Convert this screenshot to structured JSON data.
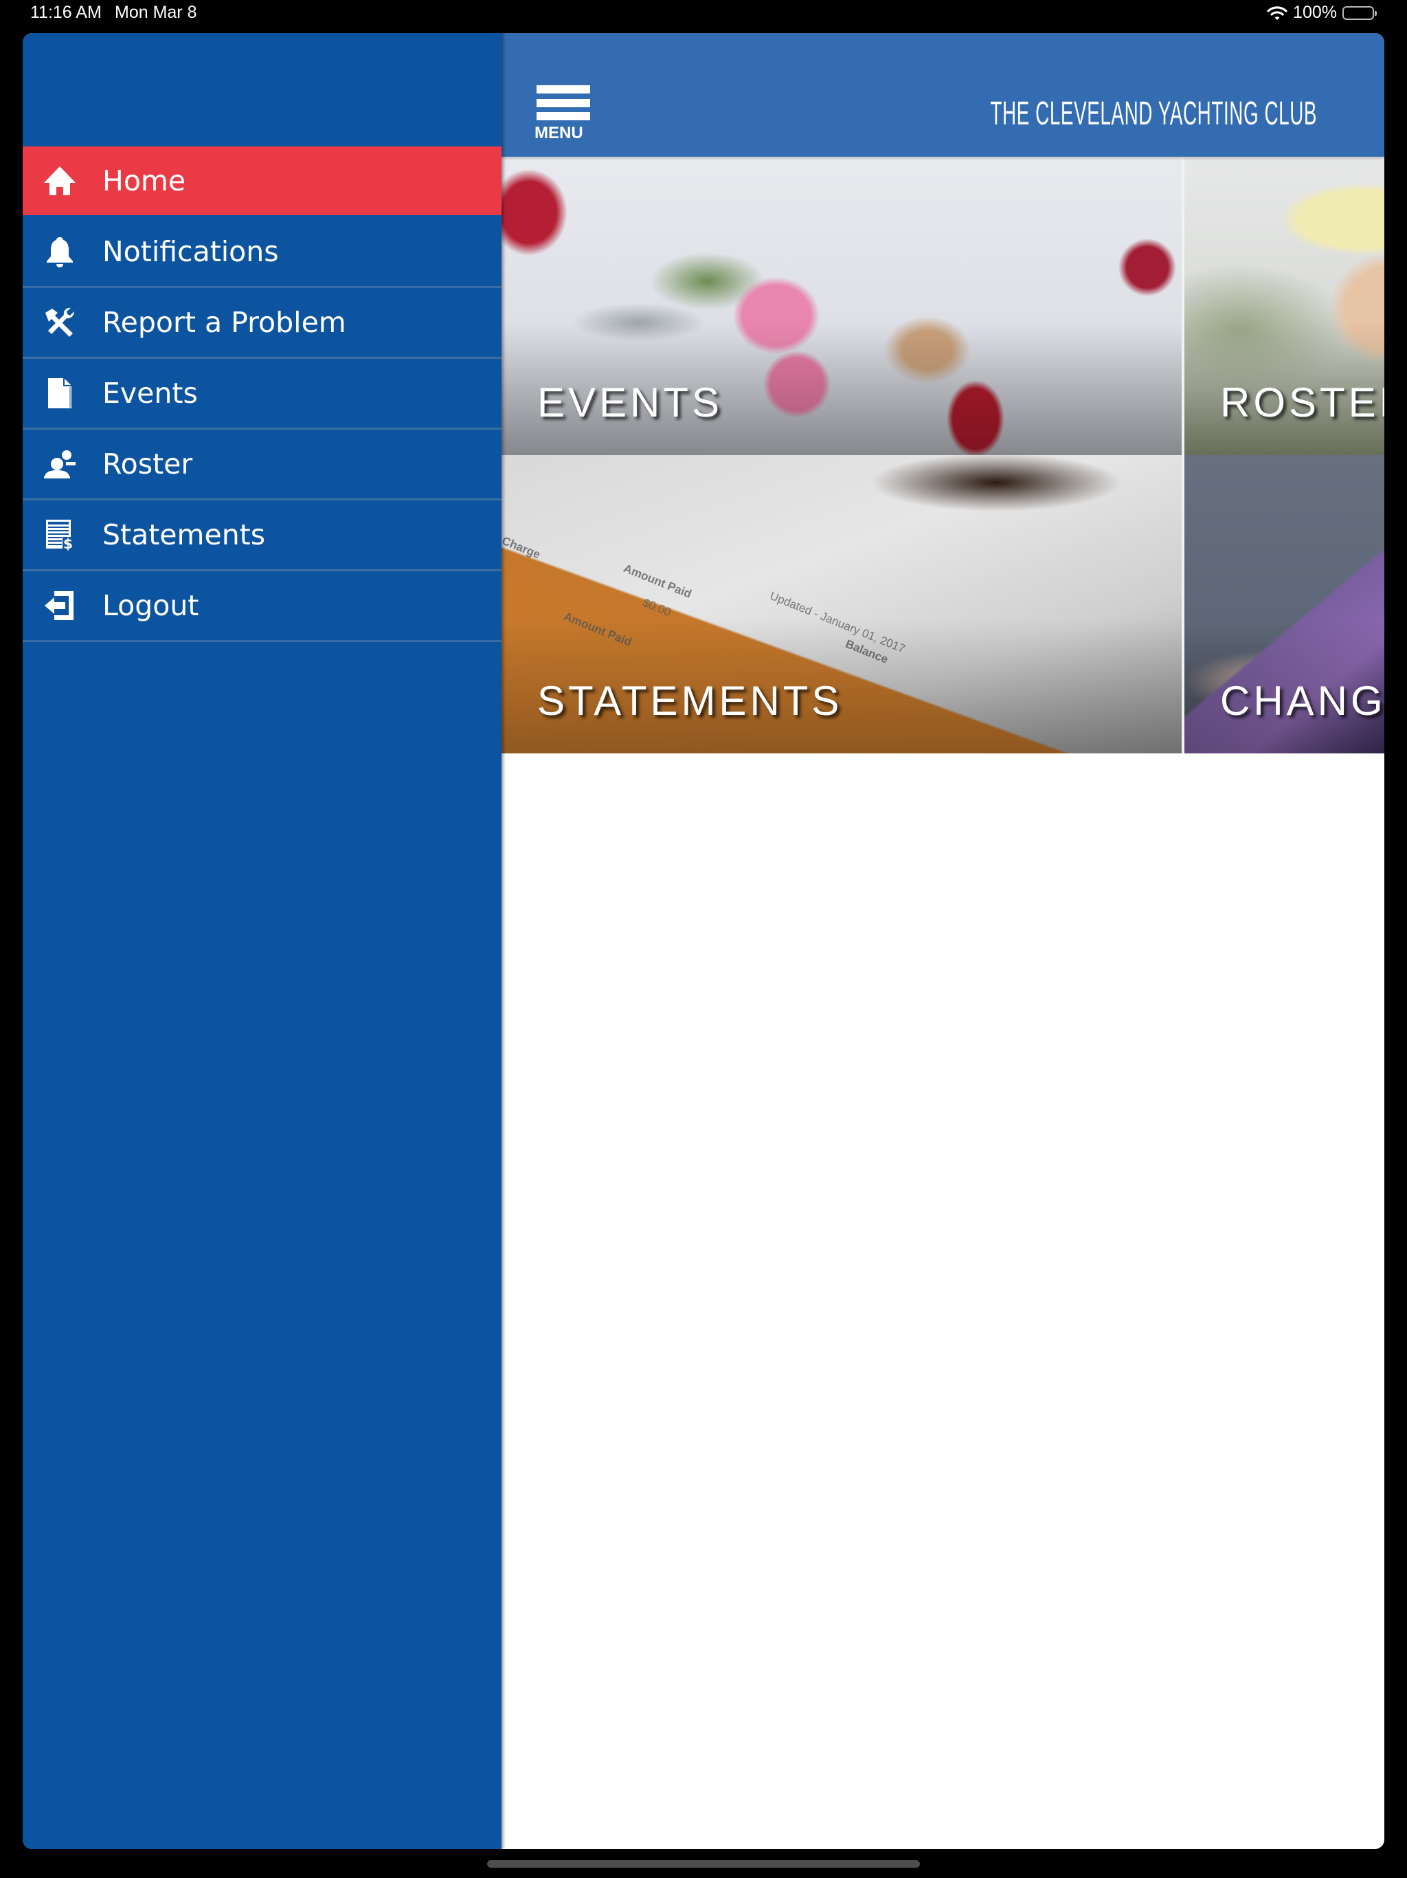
{
  "status_bar": {
    "time": "11:16 AM",
    "date": "Mon Mar 8",
    "battery": "100%",
    "wifi_icon": "wifi-icon",
    "battery_icon": "battery-icon"
  },
  "header": {
    "menu_label": "MENU",
    "menu_icon": "hamburger-icon",
    "title": "THE CLEVELAND YACHTING CLUB",
    "colors": {
      "header_bg": "#336cb0"
    }
  },
  "drawer": {
    "colors": {
      "bg": "#0d54a0",
      "active_bg": "#ea3a45",
      "separator": "#3a6da3"
    },
    "items": [
      {
        "label": "Home",
        "icon": "home-icon",
        "active": true
      },
      {
        "label": "Notifications",
        "icon": "bell-icon",
        "active": false
      },
      {
        "label": "Report a Problem",
        "icon": "tools-icon",
        "active": false
      },
      {
        "label": "Events",
        "icon": "document-icon",
        "active": false
      },
      {
        "label": "Roster",
        "icon": "people-icon",
        "active": false
      },
      {
        "label": "Statements",
        "icon": "statement-icon",
        "active": false
      },
      {
        "label": "Logout",
        "icon": "logout-icon",
        "active": false
      }
    ]
  },
  "tiles": [
    {
      "label": "EVENTS"
    },
    {
      "label": "ROSTER"
    },
    {
      "label": "STATEMENTS"
    },
    {
      "label": "CHANGE"
    }
  ],
  "statement_image_text": {
    "charge": "Charge",
    "amount_paid_1": "Amount Paid",
    "amount_paid_value": "$0.00",
    "amount_paid_2": "Amount Paid",
    "updated": "Updated - January 01, 2017",
    "balance": "Balance"
  }
}
